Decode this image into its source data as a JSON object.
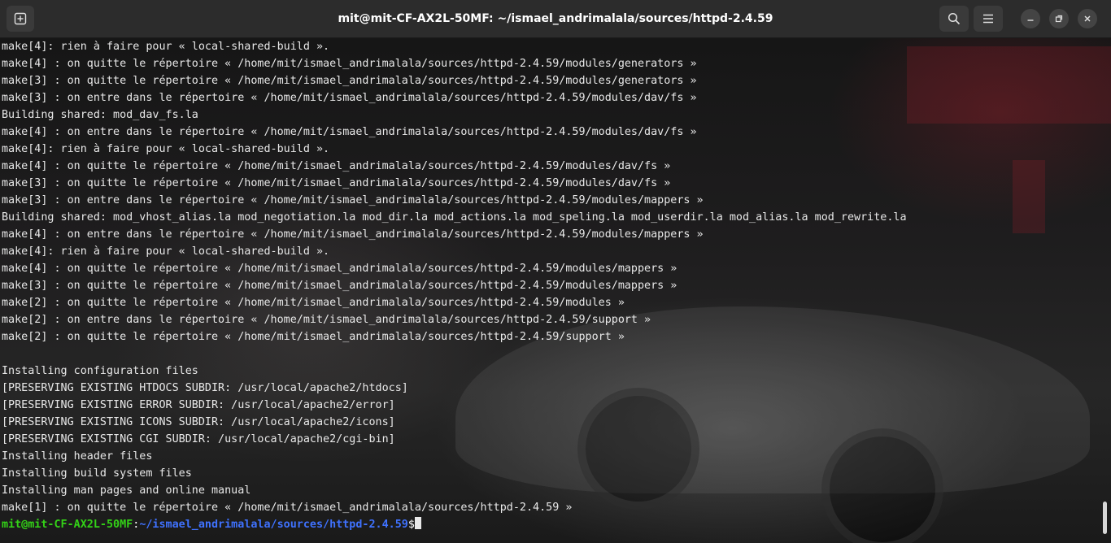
{
  "window": {
    "title": "mit@mit-CF-AX2L-50MF: ~/ismael_andrimalala/sources/httpd-2.4.59"
  },
  "icons": {
    "new_tab": "new-tab-icon",
    "search": "search-icon",
    "menu": "hamburger-menu-icon",
    "minimize": "minimize-icon",
    "maximize": "maximize-icon",
    "close": "close-icon"
  },
  "colors": {
    "prompt_user": "#33d117",
    "prompt_path": "#3f72ff",
    "text": "#e8e8e8",
    "titlebar": "#2c2c2c"
  },
  "terminal": {
    "lines": [
      "make[4]: rien à faire pour « local-shared-build ».",
      "make[4] : on quitte le répertoire « /home/mit/ismael_andrimalala/sources/httpd-2.4.59/modules/generators »",
      "make[3] : on quitte le répertoire « /home/mit/ismael_andrimalala/sources/httpd-2.4.59/modules/generators »",
      "make[3] : on entre dans le répertoire « /home/mit/ismael_andrimalala/sources/httpd-2.4.59/modules/dav/fs »",
      "Building shared: mod_dav_fs.la",
      "make[4] : on entre dans le répertoire « /home/mit/ismael_andrimalala/sources/httpd-2.4.59/modules/dav/fs »",
      "make[4]: rien à faire pour « local-shared-build ».",
      "make[4] : on quitte le répertoire « /home/mit/ismael_andrimalala/sources/httpd-2.4.59/modules/dav/fs »",
      "make[3] : on quitte le répertoire « /home/mit/ismael_andrimalala/sources/httpd-2.4.59/modules/dav/fs »",
      "make[3] : on entre dans le répertoire « /home/mit/ismael_andrimalala/sources/httpd-2.4.59/modules/mappers »",
      "Building shared: mod_vhost_alias.la mod_negotiation.la mod_dir.la mod_actions.la mod_speling.la mod_userdir.la mod_alias.la mod_rewrite.la",
      "make[4] : on entre dans le répertoire « /home/mit/ismael_andrimalala/sources/httpd-2.4.59/modules/mappers »",
      "make[4]: rien à faire pour « local-shared-build ».",
      "make[4] : on quitte le répertoire « /home/mit/ismael_andrimalala/sources/httpd-2.4.59/modules/mappers »",
      "make[3] : on quitte le répertoire « /home/mit/ismael_andrimalala/sources/httpd-2.4.59/modules/mappers »",
      "make[2] : on quitte le répertoire « /home/mit/ismael_andrimalala/sources/httpd-2.4.59/modules »",
      "make[2] : on entre dans le répertoire « /home/mit/ismael_andrimalala/sources/httpd-2.4.59/support »",
      "make[2] : on quitte le répertoire « /home/mit/ismael_andrimalala/sources/httpd-2.4.59/support »",
      "",
      "Installing configuration files",
      "[PRESERVING EXISTING HTDOCS SUBDIR: /usr/local/apache2/htdocs]",
      "[PRESERVING EXISTING ERROR SUBDIR: /usr/local/apache2/error]",
      "[PRESERVING EXISTING ICONS SUBDIR: /usr/local/apache2/icons]",
      "[PRESERVING EXISTING CGI SUBDIR: /usr/local/apache2/cgi-bin]",
      "Installing header files",
      "Installing build system files",
      "Installing man pages and online manual",
      "make[1] : on quitte le répertoire « /home/mit/ismael_andrimalala/sources/httpd-2.4.59 »"
    ],
    "prompt": {
      "user_host": "mit@mit-CF-AX2L-50MF",
      "separator": ":",
      "path": "~/ismael_andrimalala/sources/httpd-2.4.59",
      "symbol": "$"
    }
  }
}
